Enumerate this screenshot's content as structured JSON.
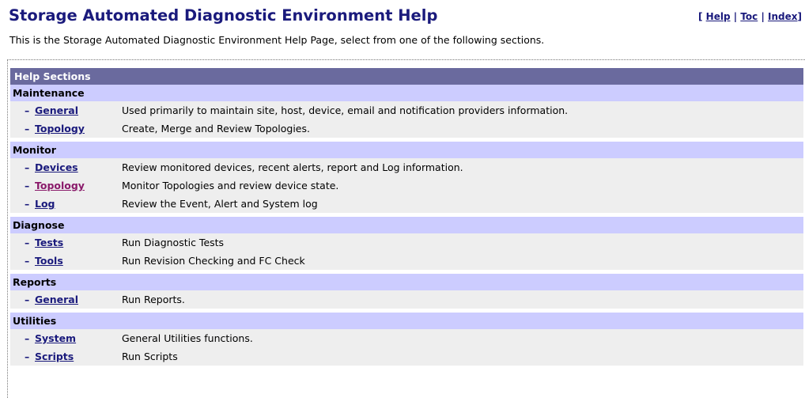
{
  "header": {
    "title": "Storage Automated Diagnostic Environment Help",
    "links": {
      "open_bracket": "[",
      "help": "Help",
      "sep1": "|",
      "toc": "Toc",
      "sep2": "|",
      "index": "Index",
      "close_bracket": "]"
    }
  },
  "intro": "This is the Storage Automated Diagnostic Environment Help Page, select from one of the following sections.",
  "table": {
    "header": "Help Sections",
    "sections": [
      {
        "name": "Maintenance",
        "items": [
          {
            "dash": "–",
            "link": "General",
            "desc": "Used primarily to maintain site, host, device, email and notification providers information."
          },
          {
            "dash": "–",
            "link": "Topology",
            "desc": "Create, Merge and Review Topologies."
          }
        ]
      },
      {
        "name": "Monitor",
        "items": [
          {
            "dash": "–",
            "link": "Devices",
            "desc": "Review monitored devices, recent alerts, report and Log information."
          },
          {
            "dash": "–",
            "link": "Topology",
            "desc": "Monitor Topologies and review device state."
          },
          {
            "dash": "–",
            "link": "Log",
            "desc": "Review the Event, Alert and System log"
          }
        ]
      },
      {
        "name": "Diagnose",
        "items": [
          {
            "dash": "–",
            "link": "Tests",
            "desc": "Run Diagnostic Tests"
          },
          {
            "dash": "–",
            "link": "Tools",
            "desc": "Run Revision Checking and FC Check"
          }
        ]
      },
      {
        "name": "Reports",
        "items": [
          {
            "dash": "–",
            "link": "General",
            "desc": "Run Reports."
          }
        ]
      },
      {
        "name": "Utilities",
        "items": [
          {
            "dash": "–",
            "link": "System",
            "desc": "General Utilities functions."
          },
          {
            "dash": "–",
            "link": "Scripts",
            "desc": "Run Scripts"
          }
        ]
      }
    ]
  },
  "colors": {
    "title": "#1a1a7c",
    "table_header_bg": "#6a6a9e",
    "section_bg": "#ccccff",
    "row_bg": "#eeeeee",
    "link": "#1a1a7c",
    "visited_link": "#8a1a6a"
  }
}
